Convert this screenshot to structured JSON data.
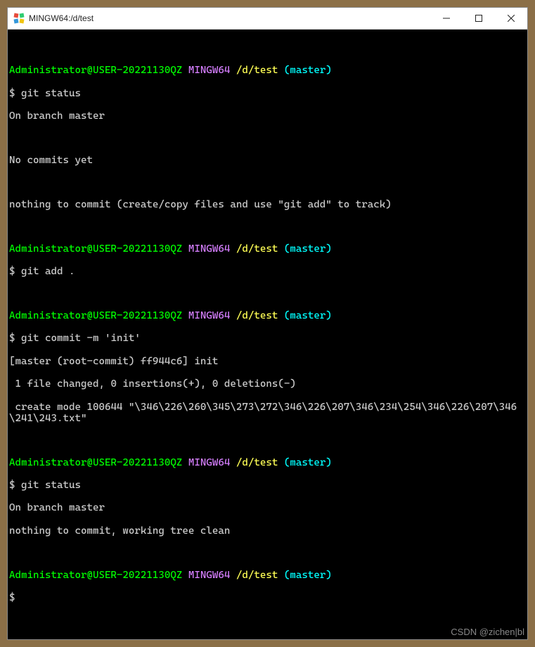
{
  "title": "MINGW64:/d/test",
  "p": {
    "user": "Administrator@USER-20221130QZ",
    "host": "MINGW64",
    "path": "/d/test",
    "branch": "(master)"
  },
  "s": {
    "dollar": "$ ",
    "dollar_alone": "$"
  },
  "cmd": {
    "status1": "git status",
    "add": "git add .",
    "commit": "git commit -m 'init'",
    "status2": "git status"
  },
  "out": {
    "on_branch": "On branch master",
    "no_commits": "No commits yet",
    "nothing1": "nothing to commit (create/copy files and use \"git add\" to track)",
    "commit_line1": "[master (root-commit) ff944c6] init",
    "commit_line2": " 1 file changed, 0 insertions(+), 0 deletions(-)",
    "commit_line3": " create mode 100644 \"\\346\\226\\260\\345\\273\\272\\346\\226\\207\\346\\234\\254\\346\\226\\207\\346\\241\\243.txt\"",
    "nothing2": "nothing to commit, working tree clean"
  },
  "watermark": "CSDN @zichen|bl"
}
